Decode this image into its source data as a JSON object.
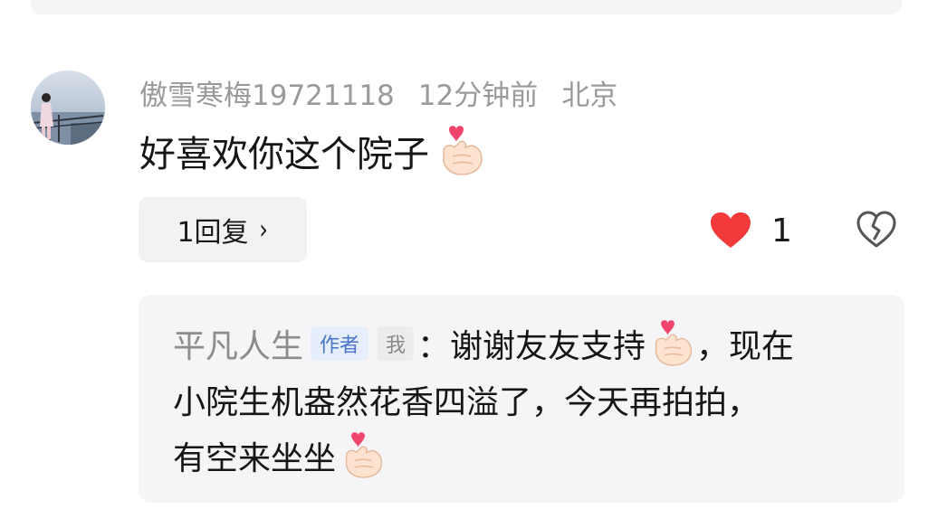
{
  "comment": {
    "username": "傲雪寒梅19721118",
    "time": "12分钟前",
    "location": "北京",
    "text": "好喜欢你这个院子",
    "emoji": "finger-heart-emoji",
    "reply_button": "1回复",
    "reply_chevron": "›",
    "likes": "1"
  },
  "reply": {
    "username": "平凡人生",
    "author_tag": "作者",
    "me_tag": "我",
    "line1_a": "：谢谢友友支持",
    "line1_b": "，现在",
    "line2": "小院生机盎然花香四溢了，今天再拍拍，",
    "line3": "有空来坐坐"
  },
  "colors": {
    "like": "#f23a3a",
    "meta": "#9a9a9a",
    "card_bg": "#f5f5f7",
    "author_tag": "#4a74c9"
  },
  "icons": {
    "like": "heart-icon",
    "dislike": "broken-heart-icon",
    "reaction": "finger-heart-emoji"
  }
}
